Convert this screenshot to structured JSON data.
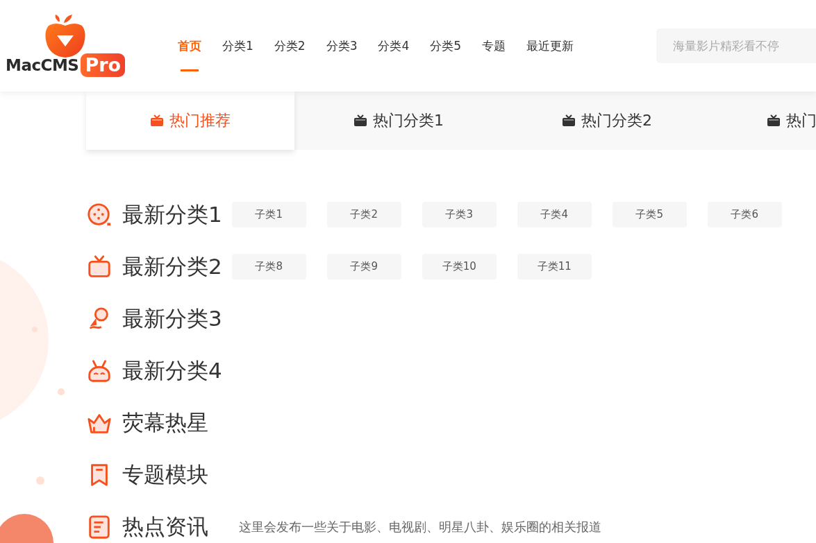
{
  "logo": {
    "text": "MacCMS",
    "badge": "Pro"
  },
  "nav": [
    {
      "label": "首页",
      "selected": true
    },
    {
      "label": "分类1",
      "selected": false
    },
    {
      "label": "分类2",
      "selected": false
    },
    {
      "label": "分类3",
      "selected": false
    },
    {
      "label": "分类4",
      "selected": false
    },
    {
      "label": "分类5",
      "selected": false
    },
    {
      "label": "专题",
      "selected": false
    },
    {
      "label": "最近更新",
      "selected": false
    }
  ],
  "search": {
    "placeholder": "海量影片精彩看不停"
  },
  "hot_tabs": [
    {
      "label": "热门推荐",
      "selected": true
    },
    {
      "label": "热门分类1",
      "selected": false
    },
    {
      "label": "热门分类2",
      "selected": false
    },
    {
      "label": "热门",
      "selected": false
    }
  ],
  "sections": [
    {
      "title": "最新分类1",
      "subcategories": [
        "子类1",
        "子类2",
        "子类3",
        "子类4",
        "子类5",
        "子类6"
      ]
    },
    {
      "title": "最新分类2",
      "subcategories": [
        "子类8",
        "子类9",
        "子类10",
        "子类11"
      ]
    },
    {
      "title": "最新分类3"
    },
    {
      "title": "最新分类4"
    },
    {
      "title": "荧幕热星"
    },
    {
      "title": "专题模块"
    },
    {
      "title": "热点资讯",
      "description": "这里会发布一些关于电影、电视剧、明星八卦、娱乐圈的相关报道"
    }
  ]
}
